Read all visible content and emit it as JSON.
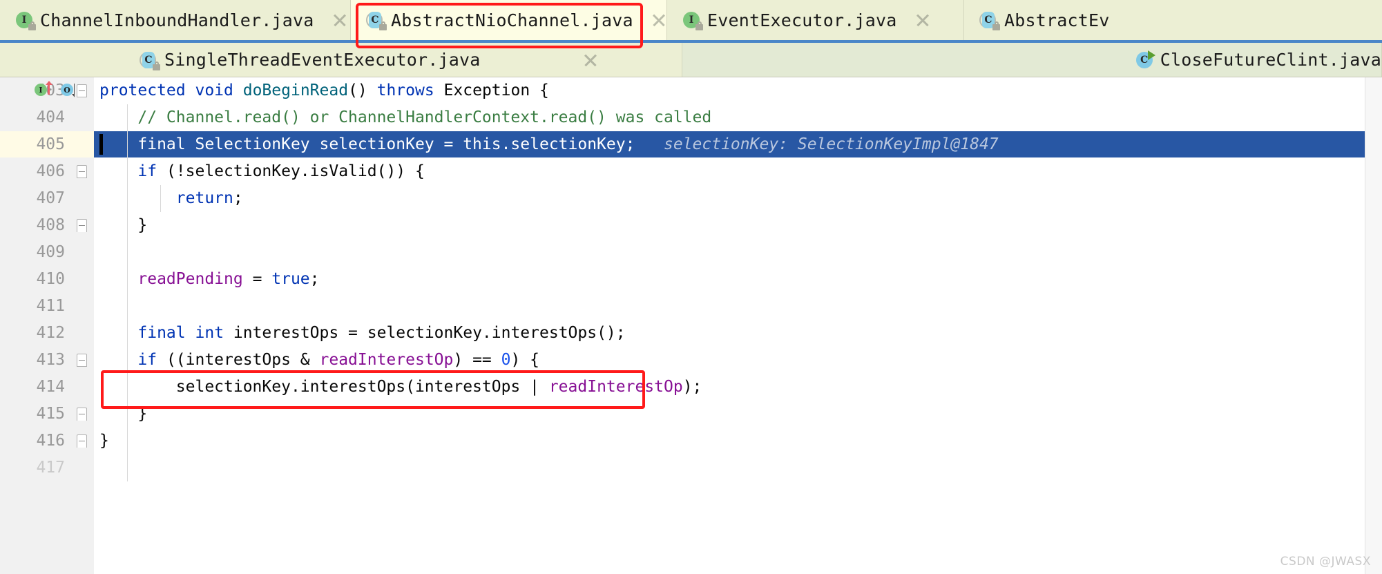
{
  "window": {
    "app": "IntelliJ IDEA Editor",
    "watermark": "CSDN @JWASX"
  },
  "tabs_row1": [
    {
      "label": "ChannelInboundHandler.java",
      "icon": "interface-icon",
      "icon_letter": "I",
      "icon_color": "#7bc67b",
      "active": false,
      "locked": true,
      "close": "×"
    },
    {
      "label": "AbstractNioChannel.java",
      "icon": "abstract-class-icon",
      "icon_letter": "C",
      "icon_color": "#8fd3e8",
      "active": true,
      "locked": true,
      "close": "×"
    },
    {
      "label": "EventExecutor.java",
      "icon": "interface-icon",
      "icon_letter": "I",
      "icon_color": "#7bc67b",
      "active": false,
      "locked": true,
      "close": "×"
    },
    {
      "label": "AbstractEv",
      "icon": "abstract-class-icon",
      "icon_letter": "C",
      "icon_color": "#8fd3e8",
      "active": false,
      "locked": true,
      "close": ""
    }
  ],
  "tabs_row2": [
    {
      "label": "SingleThreadEventExecutor.java",
      "icon": "abstract-class-icon",
      "icon_letter": "C",
      "icon_color": "#8fd3e8",
      "active": false,
      "locked": true,
      "close": "×"
    },
    {
      "label": "CloseFutureClint.java",
      "icon": "runnable-class-icon",
      "icon_letter": "C",
      "icon_color": "#7fc9e6",
      "active": false,
      "locked": false,
      "runnable": true,
      "close": ""
    }
  ],
  "gutter": {
    "markers": [
      {
        "line": "403",
        "name": "implementing-method-marker",
        "letter": "I",
        "color": "#7bc67b",
        "arrow": "up",
        "arrow_color": "#e8626b"
      },
      {
        "line": "403",
        "name": "overriding-method-marker",
        "letter": "O",
        "color": "#7fc9e6",
        "arrow": "down",
        "arrow_color": "#4d4d4d"
      }
    ]
  },
  "editor": {
    "current_line": "405",
    "lines": [
      {
        "num": "403",
        "indent": 0,
        "tokens": [
          {
            "t": "protected",
            "c": "kw"
          },
          {
            "t": " ",
            "c": "pl"
          },
          {
            "t": "void",
            "c": "kw"
          },
          {
            "t": " ",
            "c": "pl"
          },
          {
            "t": "doBeginRead",
            "c": "mth"
          },
          {
            "t": "() ",
            "c": "pl"
          },
          {
            "t": "throws",
            "c": "kw"
          },
          {
            "t": " Exception {",
            "c": "pl"
          }
        ]
      },
      {
        "num": "404",
        "indent": 1,
        "tokens": [
          {
            "t": "// Channel.read() or ChannelHandlerContext.read() was called",
            "c": "cm"
          }
        ]
      },
      {
        "num": "405",
        "indent": 1,
        "selected": true,
        "tokens": [
          {
            "t": "final SelectionKey selectionKey = this.selectionKey;",
            "c": "selected-text"
          },
          {
            "t": "   selectionKey: SelectionKeyImpl@1847",
            "c": "hint"
          }
        ]
      },
      {
        "num": "406",
        "indent": 1,
        "tokens": [
          {
            "t": "if",
            "c": "kw"
          },
          {
            "t": " (!selectionKey.isValid()) {",
            "c": "pl"
          }
        ]
      },
      {
        "num": "407",
        "indent": 2,
        "tokens": [
          {
            "t": "return",
            "c": "kw"
          },
          {
            "t": ";",
            "c": "pl"
          }
        ]
      },
      {
        "num": "408",
        "indent": 1,
        "tokens": [
          {
            "t": "}",
            "c": "pl"
          }
        ]
      },
      {
        "num": "409",
        "indent": 0,
        "tokens": []
      },
      {
        "num": "410",
        "indent": 1,
        "tokens": [
          {
            "t": "readPending",
            "c": "fld"
          },
          {
            "t": " = ",
            "c": "pl"
          },
          {
            "t": "true",
            "c": "kw"
          },
          {
            "t": ";",
            "c": "pl"
          }
        ]
      },
      {
        "num": "411",
        "indent": 0,
        "tokens": []
      },
      {
        "num": "412",
        "indent": 1,
        "tokens": [
          {
            "t": "final",
            "c": "kw"
          },
          {
            "t": " ",
            "c": "pl"
          },
          {
            "t": "int",
            "c": "kw"
          },
          {
            "t": " interestOps = selectionKey.interestOps();",
            "c": "pl"
          }
        ]
      },
      {
        "num": "413",
        "indent": 1,
        "tokens": [
          {
            "t": "if",
            "c": "kw"
          },
          {
            "t": " ((interestOps & ",
            "c": "pl"
          },
          {
            "t": "readInterestOp",
            "c": "fld"
          },
          {
            "t": ") == ",
            "c": "pl"
          },
          {
            "t": "0",
            "c": "num"
          },
          {
            "t": ") {",
            "c": "pl"
          }
        ]
      },
      {
        "num": "414",
        "indent": 2,
        "boxed": true,
        "tokens": [
          {
            "t": "selectionKey.interestOps(interestOps | ",
            "c": "pl"
          },
          {
            "t": "readInterestOp",
            "c": "fld"
          },
          {
            "t": ");",
            "c": "pl"
          }
        ]
      },
      {
        "num": "415",
        "indent": 1,
        "tokens": [
          {
            "t": "}",
            "c": "pl"
          }
        ]
      },
      {
        "num": "416",
        "indent": 0,
        "tokens": [
          {
            "t": "}",
            "c": "pl"
          }
        ]
      },
      {
        "num": "417",
        "indent": 0,
        "tokens": []
      }
    ]
  },
  "colors": {
    "tab_bar_bg": "#ecefd4",
    "active_tab_bg": "#fdfde4",
    "tab_underline": "#4a86c8",
    "annotation_red": "#ff1a1a",
    "selection_blue": "#2857a4",
    "current_line_bg": "#fffbe6",
    "keyword": "#0033b3",
    "comment": "#3a7d42",
    "field": "#871094",
    "method": "#00627a",
    "number": "#1750eb",
    "inline_hint": "#b9c7df"
  }
}
